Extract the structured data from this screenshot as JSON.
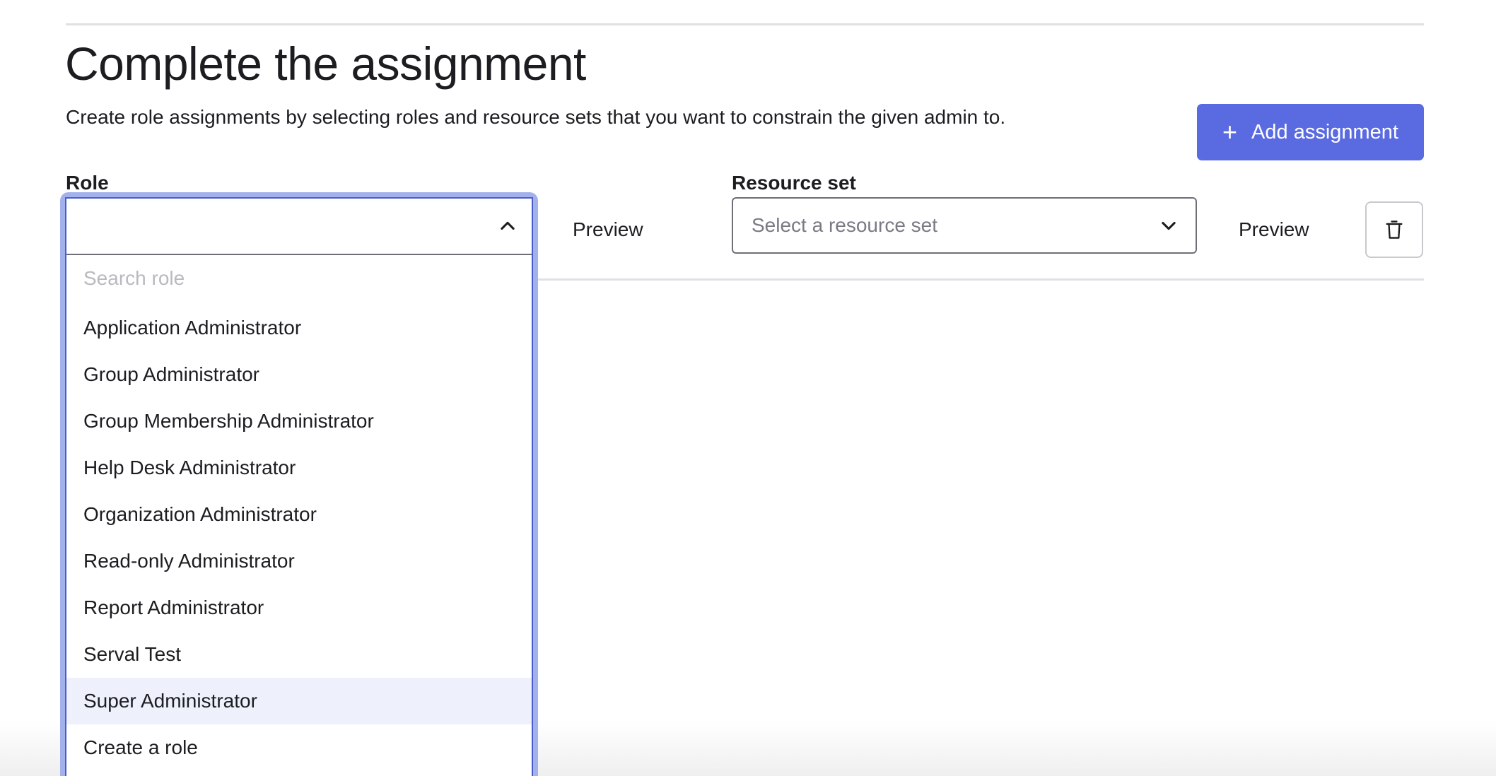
{
  "page": {
    "title": "Complete the assignment",
    "subtitle": "Create role assignments by selecting roles and resource sets that you want to constrain the given admin to."
  },
  "actions": {
    "add_assignment_label": "Add assignment",
    "add_icon": "plus-icon"
  },
  "role": {
    "label": "Role",
    "search_placeholder": "Search role",
    "dropdown_state": "open",
    "chevron_icon": "chevron-up-icon",
    "preview_label": "Preview",
    "options": [
      {
        "label": "Application Administrator"
      },
      {
        "label": "Group Administrator"
      },
      {
        "label": "Group Membership Administrator"
      },
      {
        "label": "Help Desk Administrator"
      },
      {
        "label": "Organization Administrator"
      },
      {
        "label": "Read-only Administrator"
      },
      {
        "label": "Report Administrator"
      },
      {
        "label": "Serval Test"
      },
      {
        "label": "Super Administrator",
        "highlighted": true
      },
      {
        "label": "Create a role"
      }
    ]
  },
  "resource_set": {
    "label": "Resource set",
    "placeholder": "Select a resource set",
    "chevron_icon": "chevron-down-icon",
    "preview_label": "Preview"
  },
  "delete": {
    "icon": "trash-icon"
  },
  "colors": {
    "primary": "#5a6ae1",
    "focus_ring": "#a2b0ec",
    "focus_border": "#4a5ccc",
    "highlight_bg": "#eef1fc",
    "text": "#1d1d21",
    "placeholder": "#7a7a84"
  }
}
